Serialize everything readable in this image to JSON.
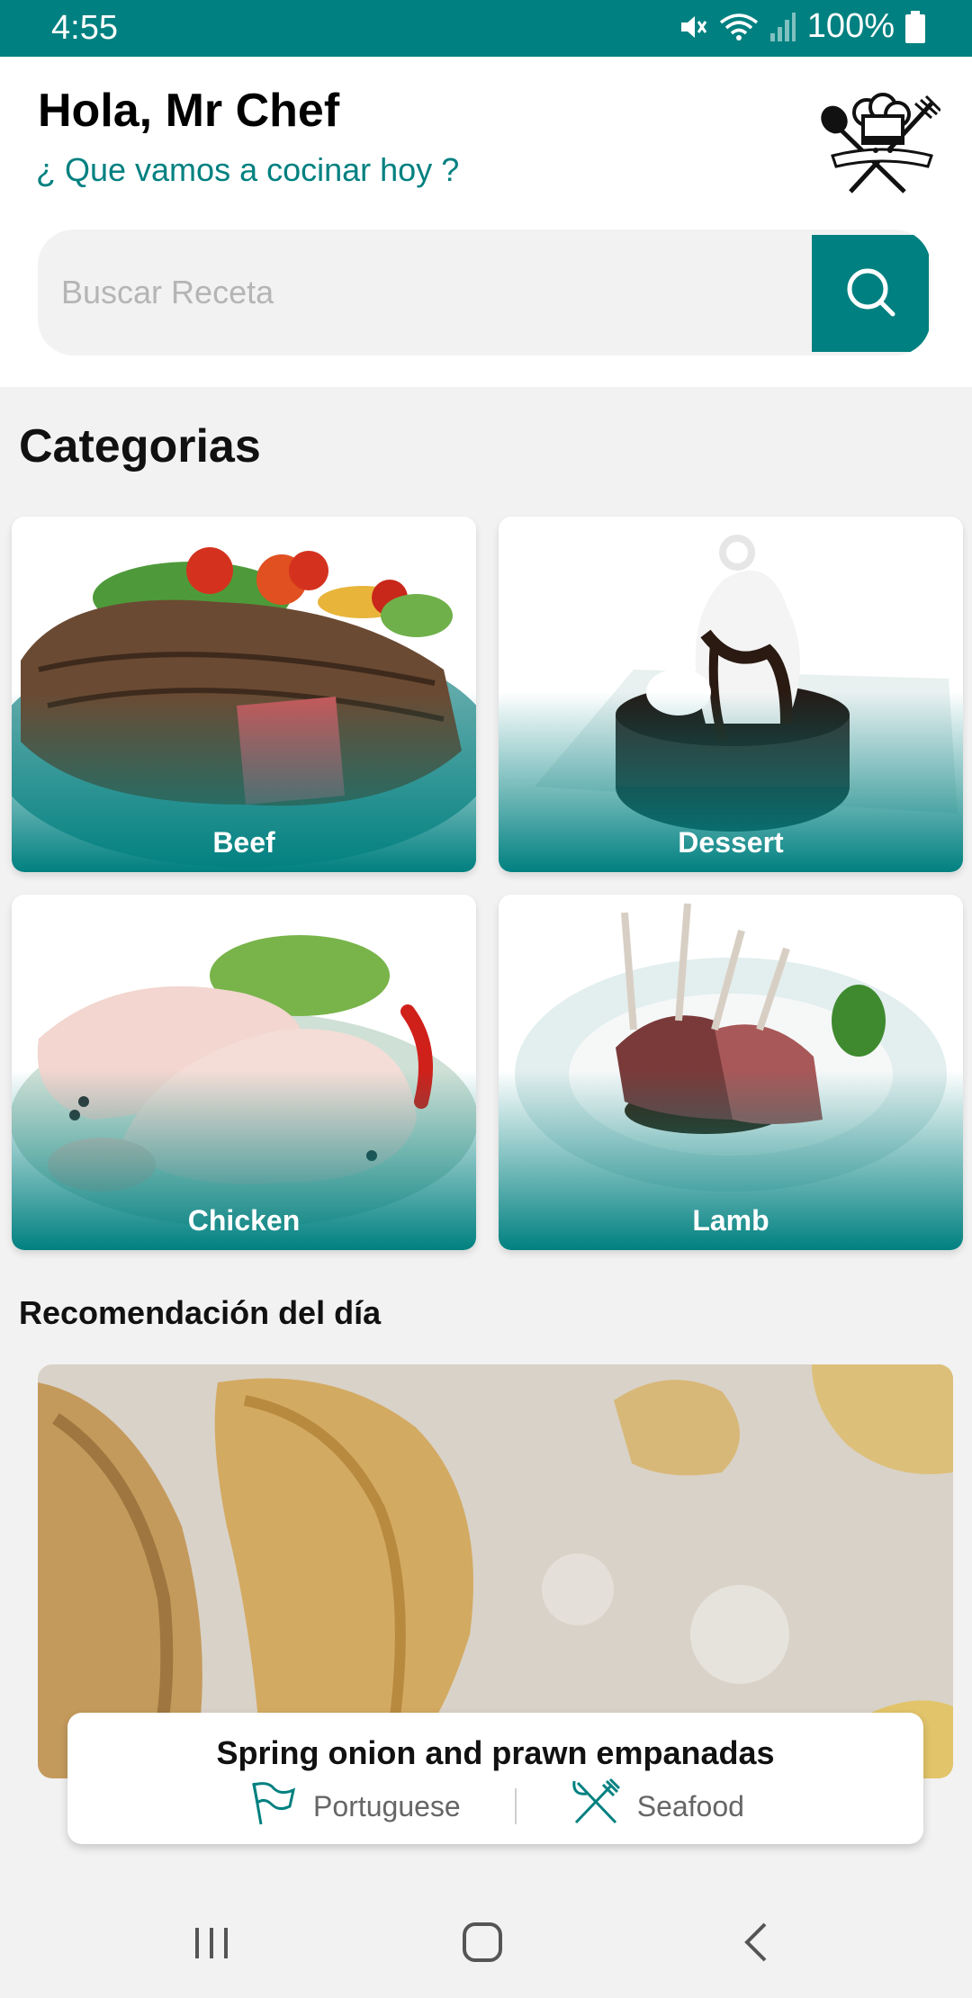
{
  "status_bar": {
    "time": "4:55",
    "battery": "100%",
    "icons": [
      "mute-icon",
      "wifi-icon",
      "signal-icon",
      "battery-icon"
    ]
  },
  "header": {
    "greeting": "Hola, Mr Chef",
    "subtitle": "¿ Que vamos a cocinar hoy ?",
    "logo_icon": "chef-hat-logo"
  },
  "search": {
    "placeholder": "Buscar Receta",
    "value": "",
    "button_icon": "search-icon"
  },
  "categories": {
    "title": "Categorias",
    "items": [
      {
        "label": "Beef"
      },
      {
        "label": "Dessert"
      },
      {
        "label": "Chicken"
      },
      {
        "label": "Lamb"
      }
    ]
  },
  "recommendation": {
    "title": "Recomendación del día",
    "recipe_name": "Spring onion and prawn empanadas",
    "area": "Portuguese",
    "category": "Seafood"
  },
  "navbar": {
    "icons": [
      "recent-apps-icon",
      "home-icon",
      "back-icon"
    ]
  },
  "colors": {
    "accent": "#008080",
    "background": "#f2f2f2"
  }
}
